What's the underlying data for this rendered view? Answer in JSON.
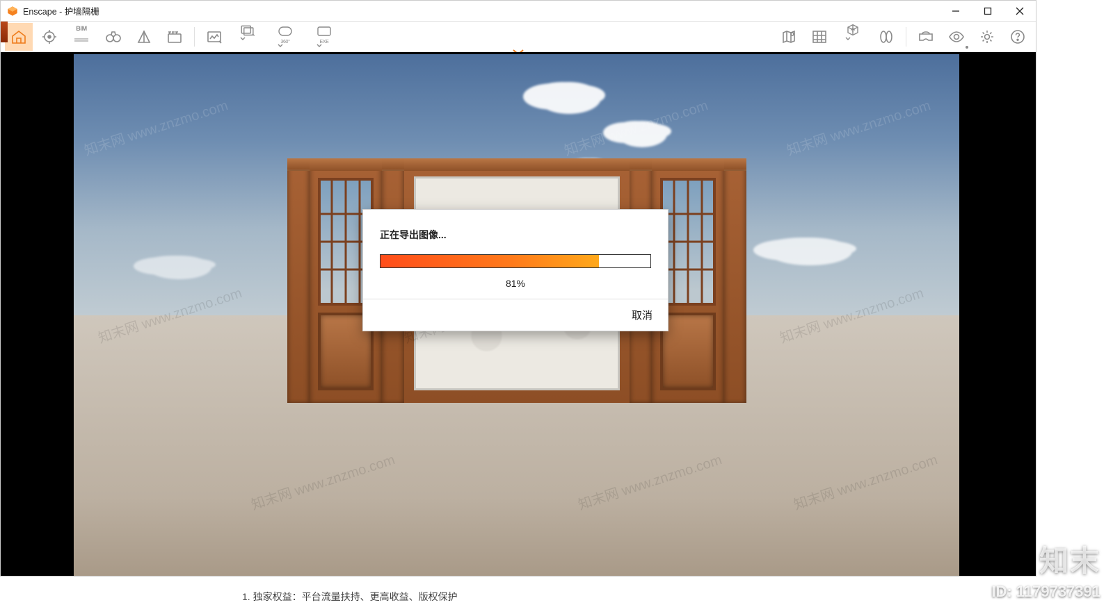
{
  "titlebar": {
    "app": "Enscape",
    "file": "护墙隔栅"
  },
  "toolbar": {
    "bim_label": "BIM",
    "deg_label": "360°",
    "exe_label": "EXE"
  },
  "dialog": {
    "title": "正在导出图像...",
    "percent_num": 81,
    "percent_text": "81%",
    "cancel": "取消"
  },
  "watermark": {
    "text": "知末网 www.znzmo.com",
    "brand": "知末",
    "id_label": "ID: 1179737391"
  },
  "footer": {
    "text": "1. 独家权益：平台流量扶持、更高收益、版权保护"
  }
}
